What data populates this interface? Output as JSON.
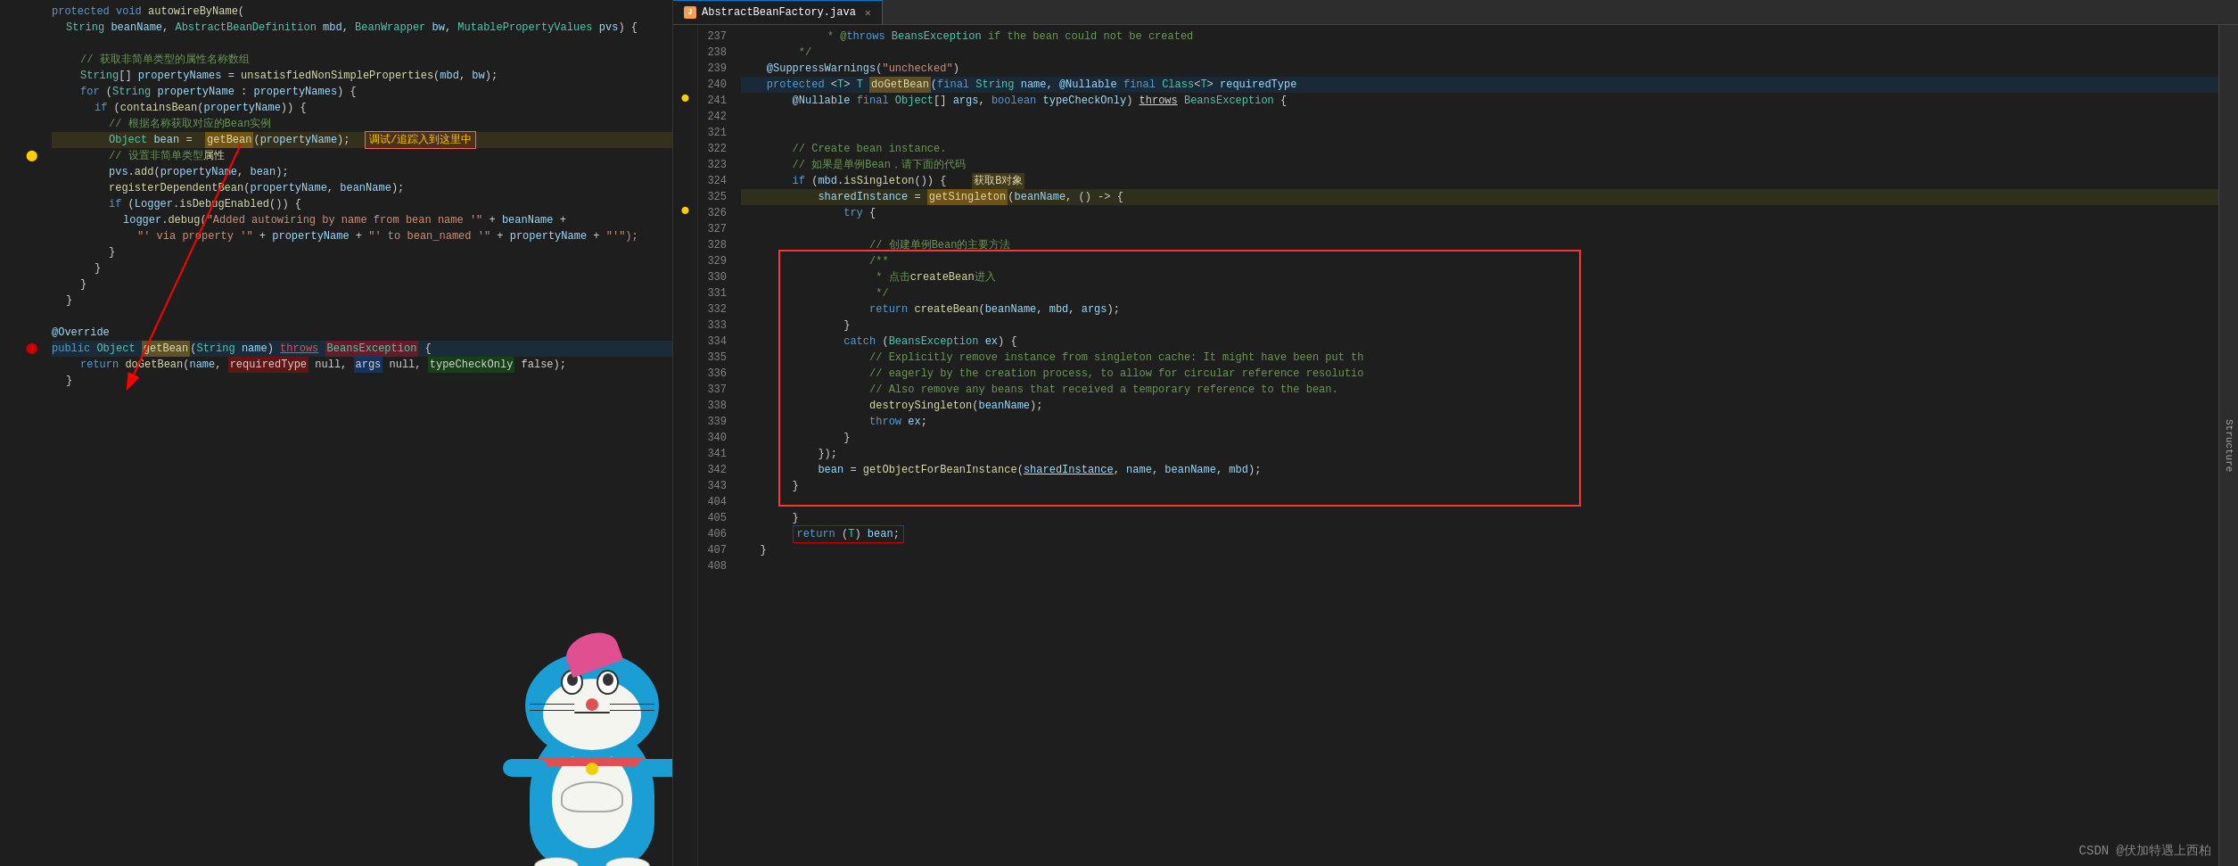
{
  "left_panel": {
    "lines": [
      {
        "num": "",
        "indent": 0,
        "content": "protected_void_autowireByName",
        "type": "method_def"
      },
      {
        "num": "",
        "indent": 1,
        "content": "String_beanName_AbstractBeanDef",
        "type": "params"
      },
      {
        "num": "",
        "indent": 0,
        "content": "blank"
      },
      {
        "num": "",
        "indent": 1,
        "content": "comment_get_non_simple"
      },
      {
        "num": "",
        "indent": 1,
        "content": "String_array_propertyNames"
      },
      {
        "num": "",
        "indent": 1,
        "content": "for_loop"
      },
      {
        "num": "",
        "indent": 2,
        "content": "if_containsBean"
      },
      {
        "num": "",
        "indent": 3,
        "content": "comment_bean_instance"
      },
      {
        "num": "",
        "indent": 3,
        "content": "Object_bean_getBean"
      },
      {
        "num": "",
        "indent": 3,
        "content": "comment_set_non_simple"
      },
      {
        "num": "",
        "indent": 3,
        "content": "pvs_add"
      },
      {
        "num": "",
        "indent": 3,
        "content": "registerDependentBean"
      },
      {
        "num": "",
        "indent": 3,
        "content": "if_logger_debug"
      },
      {
        "num": "",
        "indent": 4,
        "content": "logger_debug"
      },
      {
        "num": "",
        "indent": 4,
        "content": "via_property"
      },
      {
        "num": "",
        "indent": 3,
        "content": "close_brace"
      },
      {
        "num": "",
        "indent": 2,
        "content": "close_brace"
      },
      {
        "num": "",
        "indent": 1,
        "content": "close_brace"
      },
      {
        "num": "",
        "indent": 0,
        "content": "close_brace"
      },
      {
        "num": "",
        "indent": 0,
        "content": "blank"
      },
      {
        "num": "",
        "indent": 0,
        "content": "override"
      },
      {
        "num": "",
        "indent": 0,
        "content": "getBean_def"
      },
      {
        "num": "",
        "indent": 1,
        "content": "return_doGetBean"
      },
      {
        "num": "",
        "indent": 0,
        "content": "close_brace"
      }
    ],
    "chinese_annotations": {
      "get_non_simple": "获取非简单类型的属性名称数组",
      "bean_instance": "根据名称获取对应的Bean实例",
      "set_non_simple": "设置非简单类型属性",
      "arrow_label": "调试/追踪入到这里中"
    }
  },
  "right_panel": {
    "tab_name": "AbstractBeanFactory.java",
    "lines": [
      {
        "num": "237",
        "content": "throws_beansException_if_bean_could_not_be_created"
      },
      {
        "num": "238",
        "content": "blank_with_star"
      },
      {
        "num": "239",
        "content": "suppress_warnings_unchecked"
      },
      {
        "num": "240",
        "content": "protected_abstract_method_doGetBean"
      },
      {
        "num": "241",
        "content": "nullable_final_object_args"
      },
      {
        "num": "242",
        "content": "blank"
      },
      {
        "num": "321",
        "content": "blank"
      },
      {
        "num": "322",
        "content": "comment_create_bean_instance"
      },
      {
        "num": "323",
        "content": "comment_if_singleton_below"
      },
      {
        "num": "324",
        "content": "if_mbd_isSingleton"
      },
      {
        "num": "325",
        "content": "sharedInstance_getSingleton"
      },
      {
        "num": "326",
        "content": "try_open"
      },
      {
        "num": "327",
        "content": "blank"
      },
      {
        "num": "328",
        "content": "comment_createBean_main_method"
      },
      {
        "num": "329",
        "content": "javadoc_open"
      },
      {
        "num": "330",
        "content": "click_createBean"
      },
      {
        "num": "331",
        "content": "javadoc_close"
      },
      {
        "num": "332",
        "content": "return_createBean"
      },
      {
        "num": "333",
        "content": "close_try"
      },
      {
        "num": "334",
        "content": "catch_beansException"
      },
      {
        "num": "335",
        "content": "comment_explicitly_remove"
      },
      {
        "num": "336",
        "content": "comment_eagerly"
      },
      {
        "num": "337",
        "content": "comment_also_remove"
      },
      {
        "num": "338",
        "content": "destroySingleton"
      },
      {
        "num": "339",
        "content": "throw_ex"
      },
      {
        "num": "340",
        "content": "close_catch"
      },
      {
        "num": "341",
        "content": "close_lambda"
      },
      {
        "num": "342",
        "content": "bean_getObjectForBeanInstance"
      },
      {
        "num": "343",
        "content": "close_if"
      },
      {
        "num": "404",
        "content": "blank"
      },
      {
        "num": "405",
        "content": "close_method"
      },
      {
        "num": "406",
        "content": "return_T_bean"
      },
      {
        "num": "407",
        "content": "close_brace"
      },
      {
        "num": "408",
        "content": "blank"
      }
    ],
    "chinese_notes": {
      "get_B": "获取B对象",
      "singleton_code_below": "如果是单例Bean，请下面的代码",
      "createBean_main": "创建单例Bean的主要方法",
      "click_createBean": "点击 createBean 进入"
    }
  },
  "watermark": "CSDN @伏加特遇上西柏",
  "colors": {
    "keyword": "#569cd6",
    "type": "#4ec9b0",
    "method": "#dcdcaa",
    "string": "#ce9178",
    "comment": "#6a9955",
    "variable": "#9cdcfe",
    "number": "#b5cea8",
    "red": "#f44747",
    "yellow": "#ffcc00",
    "accent": "#007acc"
  }
}
